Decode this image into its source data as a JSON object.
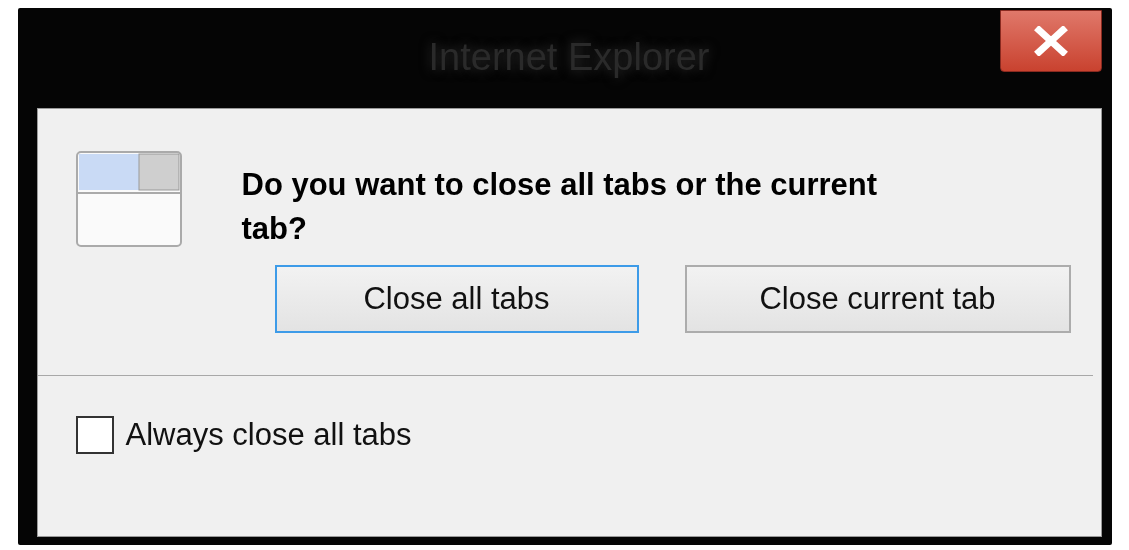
{
  "window": {
    "title": "Internet Explorer"
  },
  "message": "Do you want to close all tabs or the current tab?",
  "buttons": [
    {
      "label": "Close all tabs",
      "focused": true
    },
    {
      "label": "Close current tab",
      "focused": false
    }
  ],
  "checkbox": {
    "label": "Always close all tabs",
    "checked": false
  }
}
